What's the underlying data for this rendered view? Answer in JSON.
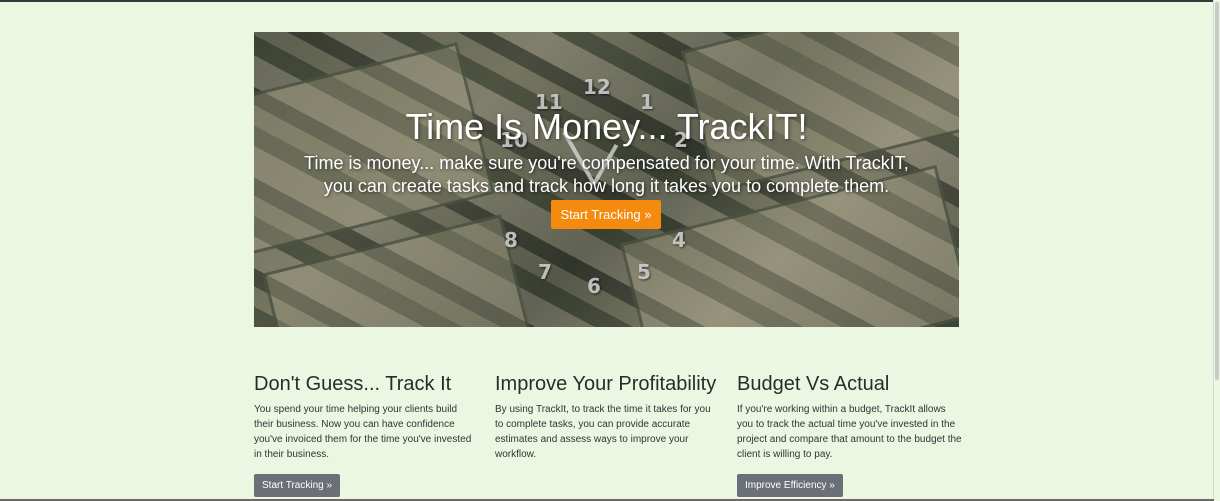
{
  "hero": {
    "title": "Time Is Money... TrackIT!",
    "text": "Time is money... make sure you're compensated for your time. With TrackIT, you can create tasks and track how long it takes you to complete them.",
    "button_label": "Start Tracking »",
    "clock_numbers": [
      "12",
      "1",
      "11",
      "10",
      "2",
      "8",
      "4",
      "7",
      "5",
      "6"
    ]
  },
  "features": [
    {
      "title": "Don't Guess... Track It",
      "text": "You spend your time helping your clients build their business. Now you can have confidence you've invoiced them for the time you've invested in their business.",
      "button_label": "Start Tracking »"
    },
    {
      "title": "Improve Your Profitability",
      "text": "By using TrackIt, to track the time it takes for you to complete tasks, you can provide accurate estimates and assess ways to improve your workflow.",
      "button_label": ""
    },
    {
      "title": "Budget Vs Actual",
      "text": "If you're working within a budget, TrackIt allows you to track the actual time you've invested in the project and compare that amount to the budget the client is willing to pay.",
      "button_label": "Improve Efficiency »"
    }
  ],
  "colors": {
    "background": "#ecf7e2",
    "accent": "#f48a0e",
    "button": "#6b7078"
  }
}
